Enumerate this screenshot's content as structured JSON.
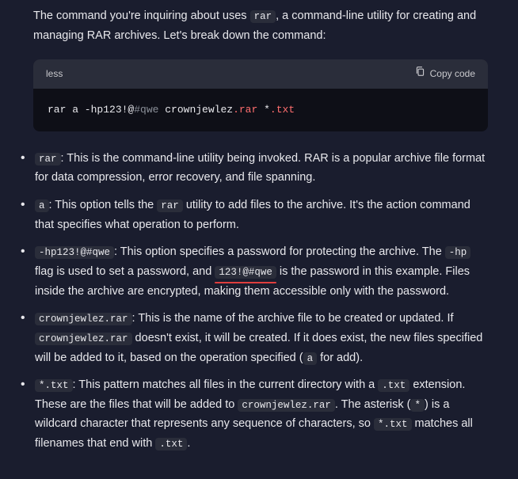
{
  "intro_part1": "The command you're inquiring about uses ",
  "intro_code": "rar",
  "intro_part2": ", a command-line utility for creating and managing RAR archives. Let's break down the command:",
  "codeblock": {
    "lang": "less",
    "copy_label": "Copy code",
    "cmd_prefix": "rar a -hp123!@",
    "cmd_hash": "#qwe",
    "cmd_mid": " crownjewlez",
    "cmd_rar_ext": ".rar",
    "cmd_sp": " *",
    "cmd_txt": ".txt"
  },
  "items": [
    {
      "code": "rar",
      "t1": ": This is the command-line utility being invoked. RAR is a popular archive file format for data compression, error recovery, and file spanning."
    },
    {
      "code": "a",
      "t1": ": This option tells the ",
      "code2": "rar",
      "t2": " utility to add files to the archive. It's the action command that specifies what operation to perform."
    },
    {
      "code": "-hp123!@#qwe",
      "t1": ": This option specifies a password for protecting the archive. The ",
      "code2": "-hp",
      "t2": " flag is used to set a password, and ",
      "red": "123!@#qwe",
      "t3": " is the password in this example. Files inside the archive are encrypted, making them accessible only with the password."
    },
    {
      "code": "crownjewlez.rar",
      "t1": ": This is the name of the archive file to be created or updated. If ",
      "code2": "crownjewlez.rar",
      "t2": " doesn't exist, it will be created. If it does exist, the new files specified will be added to it, based on the operation specified (",
      "code3": "a",
      "t3": " for add)."
    },
    {
      "code": "*.txt",
      "t1": ": This pattern matches all files in the current directory with a ",
      "code2": ".txt",
      "t2": " extension. These are the files that will be added to ",
      "code3": "crownjewlez.rar",
      "t3": ". The asterisk (",
      "code4": "*",
      "t4": ") is a wildcard character that represents any sequence of characters, so ",
      "code5": "*.txt",
      "t5": " matches all filenames that end with ",
      "code6": ".txt",
      "t6": "."
    }
  ]
}
